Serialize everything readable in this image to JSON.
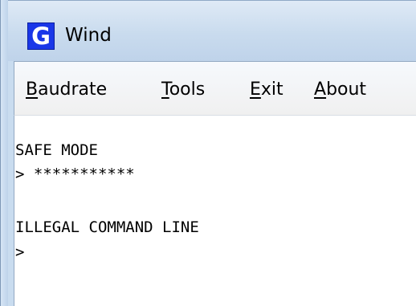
{
  "window": {
    "title": "Wind",
    "icon_letter": "G"
  },
  "menu": {
    "items": [
      {
        "mnemonic": "B",
        "rest": "audrate"
      },
      {
        "mnemonic": "T",
        "rest": "ools"
      },
      {
        "mnemonic": "E",
        "rest": "xit"
      },
      {
        "mnemonic": "A",
        "rest": "bout"
      }
    ]
  },
  "console": {
    "lines": [
      "SAFE MODE",
      "> ***********",
      "",
      "ILLEGAL COMMAND LINE",
      ">"
    ]
  },
  "colors": {
    "icon_background": "#1a37e8",
    "frame": "#c9dcef",
    "console_background": "#ffffff"
  }
}
